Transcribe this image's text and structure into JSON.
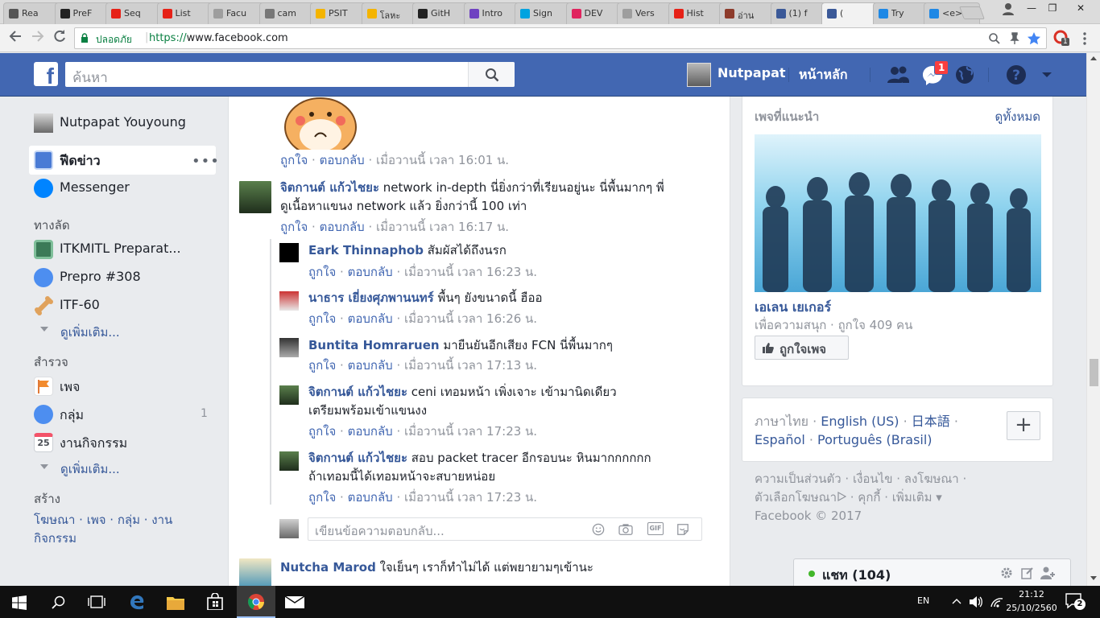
{
  "browser": {
    "tabs": [
      {
        "label": "Rea",
        "icon": "reader-icon",
        "color": "#555555"
      },
      {
        "label": "PreF",
        "icon": "github-icon",
        "color": "#222222"
      },
      {
        "label": "Seq",
        "icon": "youtube-icon",
        "color": "#e62117"
      },
      {
        "label": "List",
        "icon": "youtube-icon",
        "color": "#e62117"
      },
      {
        "label": "Facu",
        "icon": "page-icon",
        "color": "#9e9e9e"
      },
      {
        "label": "cam",
        "icon": "code-icon",
        "color": "#777777"
      },
      {
        "label": "PSIT",
        "icon": "drive-icon",
        "color": "#f4b400"
      },
      {
        "label": "โลหะ",
        "icon": "drive-icon",
        "color": "#f4b400"
      },
      {
        "label": "GitH",
        "icon": "github-icon",
        "color": "#222222"
      },
      {
        "label": "Intro",
        "icon": "list-icon",
        "color": "#6f42c1"
      },
      {
        "label": "Sign",
        "icon": "u-icon",
        "color": "#00a3e0"
      },
      {
        "label": "DEV",
        "icon": "dev-icon",
        "color": "#e0245e"
      },
      {
        "label": "Vers",
        "icon": "page-icon",
        "color": "#9e9e9e"
      },
      {
        "label": "Hist",
        "icon": "youtube-icon",
        "color": "#e62117"
      },
      {
        "label": "อ่าน",
        "icon": "paw-icon",
        "color": "#8d3b2b"
      },
      {
        "label": "(1) f",
        "icon": "facebook-icon",
        "color": "#3b5998"
      },
      {
        "label": "(",
        "icon": "facebook-icon",
        "color": "#3b5998"
      },
      {
        "label": "Try",
        "icon": "code-icon",
        "color": "#1e88e5"
      },
      {
        "label": "<e>",
        "icon": "it-icon",
        "color": "#1e88e5"
      }
    ],
    "active_tab_index": 16,
    "secure_label": "ปลอดภัย",
    "url_scheme": "https://",
    "url_host": "www.facebook.com",
    "ext_badge": "1"
  },
  "fb": {
    "search_placeholder": "ค้นหา",
    "profile_name": "Nutpapat",
    "home_label": "หน้าหลัก",
    "messages_badge": "1"
  },
  "left": {
    "user_full_name": "Nutpapat Youyoung",
    "feed_label": "ฟีดข่าว",
    "messenger_label": "Messenger",
    "shortcuts_header": "ทางลัด",
    "shortcuts": [
      {
        "label": "ITKMITL Preparat..."
      },
      {
        "label": "Prepro #308"
      },
      {
        "label": "ITF-60"
      }
    ],
    "see_more_1": "ดูเพิ่มเติม...",
    "explore_header": "สำรวจ",
    "explore": [
      {
        "label": "เพจ",
        "count": ""
      },
      {
        "label": "กลุ่ม",
        "count": "1"
      },
      {
        "label": "งานกิจกรรม",
        "count": ""
      }
    ],
    "calendar_day": "25",
    "see_more_2": "ดูเพิ่มเติม...",
    "create_header": "สร้าง",
    "create_links_1": "โฆษณา · เพจ · กลุ่ม · งาน",
    "create_links_2": "กิจกรรม"
  },
  "feed": {
    "like": "ถูกใจ",
    "reply": "ตอบกลับ",
    "comments": [
      {
        "name": "",
        "text": "",
        "time": "เมื่อวานนี้ เวลา 16:01 น."
      },
      {
        "name": "จิตกานต์ แก้วไชยะ",
        "text": "network in-depth นี่ยิ่งกว่าที่เรียนอยู่นะ นี่พื้นมากๆ พี่",
        "text2": "ดูเนื้อหาแขนง network แล้ว ยิ่งกว่านี้ 100 เท่า",
        "time": "เมื่อวานนี้ เวลา 16:17 น."
      },
      {
        "name": "Eark Thinnaphob",
        "text": "สัมผัสได้ถึงนรก",
        "time": "เมื่อวานนี้ เวลา 16:23 น."
      },
      {
        "name": "นาธาร เยี่ยงศุภพานนทร์",
        "text": "พื้นๆ ยังขนาดนี้ ฮืออ",
        "time": "เมื่อวานนี้ เวลา 16:26 น."
      },
      {
        "name": "Buntita Homraruen",
        "text": "มายืนยันอีกเสียง FCN นี่พื้นมากๆ",
        "time": "เมื่อวานนี้ เวลา 17:13 น."
      },
      {
        "name": "จิตกานต์ แก้วไชยะ",
        "text": "ceni เทอมหน้า เพิ่งเจาะ เข้ามานิดเดียว",
        "text2": "เตรียมพร้อมเข้าแขนงง",
        "time": "เมื่อวานนี้ เวลา 17:23 น."
      },
      {
        "name": "จิตกานต์ แก้วไชยะ",
        "text": "สอบ packet tracer อีกรอบนะ หินมากกกกกก",
        "text2": "ถ้าเทอมนี้ได้เทอมหน้าจะสบายหน่อย",
        "time": "เมื่อวานนี้ เวลา 17:23 น."
      },
      {
        "name": "Nutcha Marod",
        "text": "ใจเย็นๆ เราก็ทำไม่ได้ แต่พยายามๆเข้านะ",
        "time": ""
      }
    ],
    "reply_placeholder": "เขียนข้อความตอบกลับ...",
    "gif_label": "GIF"
  },
  "right": {
    "suggested_title": "เพจที่แนะนำ",
    "see_all": "ดูทั้งหมด",
    "page_name": "เอเลน เยเกอร์",
    "page_meta": "เพื่อความสนุก · ถูกใจ 409 คน",
    "like_page": "ถูกใจเพจ",
    "lang_current": "ภาษาไทย",
    "lang_en": "English (US)",
    "lang_ja": "日本語",
    "lang_es": "Español",
    "lang_pt": "Português (Brasil)",
    "footer_1": "ความเป็นส่วนตัว · เงื่อนไข · ลงโฆษณา ·",
    "footer_2": "ตัวเลือกโฆษณา",
    "footer_2b": " · คุกกี้ · เพิ่มเติม ▾",
    "footer_3": "Facebook © 2017"
  },
  "chat": {
    "label": "แชท (104)",
    "status_color": "#42b72a"
  },
  "taskbar": {
    "language": "EN",
    "time": "21:12",
    "date": "25/10/2560",
    "notifications": "2"
  }
}
